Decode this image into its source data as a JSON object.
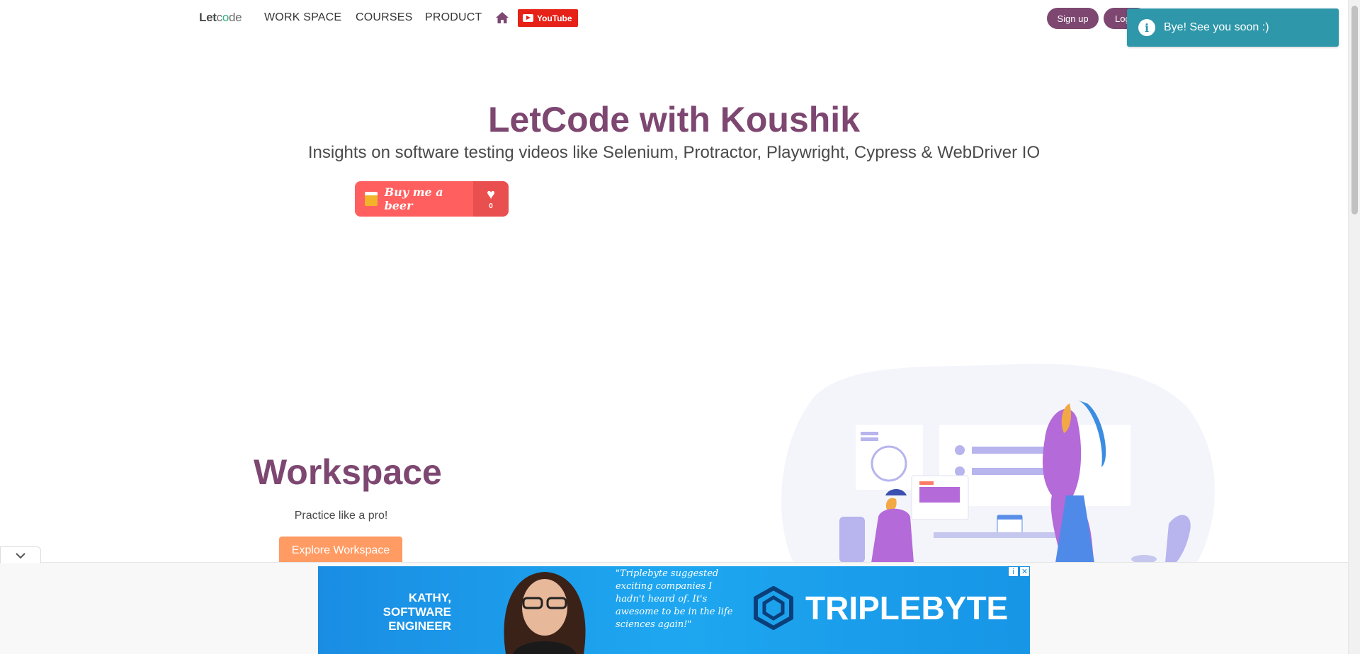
{
  "navbar": {
    "brand_let": "Let",
    "brand_code": "c",
    "brand_o": "o",
    "brand_de": "de",
    "items": [
      "WORK SPACE",
      "COURSES",
      "PRODUCT"
    ],
    "youtube_label": "YouTube",
    "signup_label": "Sign up",
    "login_label": "Log"
  },
  "toast": {
    "message": "Bye! See you soon :)",
    "icon": "info-icon"
  },
  "hero": {
    "title": "LetCode with Koushik",
    "subtitle": "Insights on software testing videos like Selenium, Protractor, Playwright, Cypress & WebDriver IO",
    "beer_label": "Buy me a beer",
    "beer_count": "0"
  },
  "workspace": {
    "title": "Workspace",
    "subtitle": "Practice like a pro!",
    "button_label": "Explore Workspace"
  },
  "ad": {
    "name_line1": "KATHY,",
    "name_line2": "SOFTWARE",
    "name_line3": "ENGINEER",
    "quote": "\"Triplebyte suggested exciting companies I hadn't heard of. It's awesome to be in the life sciences again!\"",
    "logo_text": "TRIPLEBYTE"
  },
  "colors": {
    "brand": "#7d4771",
    "toast": "#2e97a9",
    "workspace_button": "#ff9b63",
    "youtube": "#e62117",
    "beer": "#ff5f5f"
  }
}
